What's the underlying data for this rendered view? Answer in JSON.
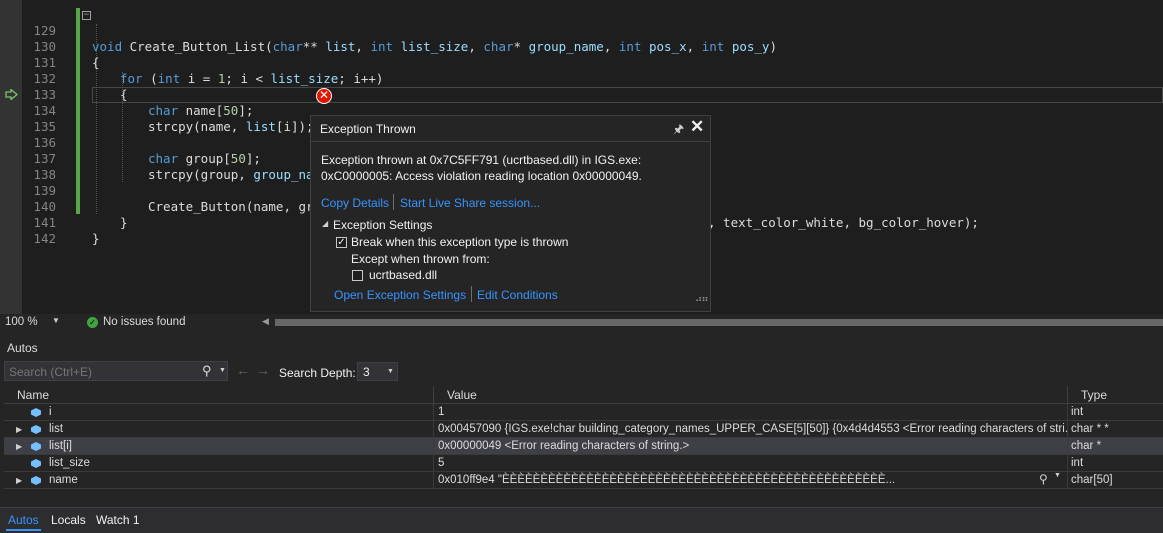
{
  "editor": {
    "lines": [
      {
        "num": "129"
      },
      {
        "num": "130"
      },
      {
        "num": "131"
      },
      {
        "num": "132"
      },
      {
        "num": "133"
      },
      {
        "num": "134"
      },
      {
        "num": "135"
      },
      {
        "num": "136"
      },
      {
        "num": "137"
      },
      {
        "num": "138"
      },
      {
        "num": "139"
      },
      {
        "num": "140"
      },
      {
        "num": "141"
      },
      {
        "num": "142"
      }
    ],
    "code": {
      "l129_kw_void": "void",
      "l129_fn": " Create_Button_List(",
      "l129_kw_char1": "char",
      "l129_t1": "** ",
      "l129_p1": "list",
      "l129_t2": ", ",
      "l129_kw_int1": "int",
      "l129_t3": " ",
      "l129_p2": "list_size",
      "l129_t4": ", ",
      "l129_kw_char2": "char",
      "l129_t5": "* ",
      "l129_p3": "group_name",
      "l129_t6": ", ",
      "l129_kw_int2": "int",
      "l129_t7": " ",
      "l129_p4": "pos_x",
      "l129_t8": ", ",
      "l129_kw_int3": "int",
      "l129_t9": " ",
      "l129_p5": "pos_y",
      "l129_t10": ")",
      "l130": "{",
      "l131_kw_for": "for",
      "l131_a": " (",
      "l131_kw_int": "int",
      "l131_b": " i = ",
      "l131_n1": "1",
      "l131_c": "; i < ",
      "l131_p": "list_size",
      "l131_d": "; i++)",
      "l132": "{",
      "l133_kw": "char",
      "l133_rest": " name[",
      "l133_n": "50",
      "l133_end": "];",
      "l134_a": "strcpy(name, ",
      "l134_p": "list",
      "l134_b": "[i]);",
      "l136_kw": "char",
      "l136_rest": " group[",
      "l136_n": "50",
      "l136_end": "];",
      "l137_a": "strcpy(group, ",
      "l137_p": "group_nam",
      "l139_a": "Create_Button(name, gro",
      "l139_tail": ", text_color_white, bg_color_hover);",
      "l140": "}",
      "l141": "}"
    }
  },
  "exception": {
    "title": "Exception Thrown",
    "message_line1": "Exception thrown at 0x7C5FF791 (ucrtbased.dll) in IGS.exe:",
    "message_line2": "0xC0000005: Access violation reading location 0x00000049.",
    "copy_details": "Copy Details",
    "live_share": "Start Live Share session...",
    "settings_header": "Exception Settings",
    "break_label": "Break when this exception type is thrown",
    "break_checked": true,
    "except_label": "Except when thrown from:",
    "ucrt_label": "ucrtbased.dll",
    "ucrt_checked": false,
    "open_settings": "Open Exception Settings",
    "edit_conditions": "Edit Conditions"
  },
  "status": {
    "zoom": "100 %",
    "issues": "No issues found"
  },
  "autos": {
    "title": "Autos",
    "search_placeholder": "Search (Ctrl+E)",
    "search_depth_label": "Search Depth:",
    "search_depth_value": "3",
    "columns": {
      "name": "Name",
      "value": "Value",
      "type": "Type"
    },
    "rows": [
      {
        "name": "i",
        "value": "1",
        "type": "int",
        "expandable": false
      },
      {
        "name": "list",
        "value": "0x00457090 {IGS.exe!char building_category_names_UPPER_CASE[5][50]} {0x4d4d4553 <Error reading characters of stri...",
        "type": "char * *",
        "expandable": true
      },
      {
        "name": "list[i]",
        "value": "0x00000049 <Error reading characters of string.>",
        "type": "char *",
        "expandable": true
      },
      {
        "name": "list_size",
        "value": "5",
        "type": "int",
        "expandable": false
      },
      {
        "name": "name",
        "value": "0x010ff9e4 \"ÈÈÈÈÈÈÈÈÈÈÈÈÈÈÈÈÈÈÈÈÈÈÈÈÈÈÈÈÈÈÈÈÈÈÈÈÈÈÈÈÈÈÈÈÈÈÈÈÈÈ...",
        "type": "char[50]",
        "expandable": true
      }
    ],
    "tabs": [
      "Autos",
      "Locals",
      "Watch 1"
    ]
  },
  "colors": {
    "accent": "#3794ff",
    "error": "#e51400",
    "ok": "#3fa63f",
    "change_bar": "#57a64a"
  }
}
